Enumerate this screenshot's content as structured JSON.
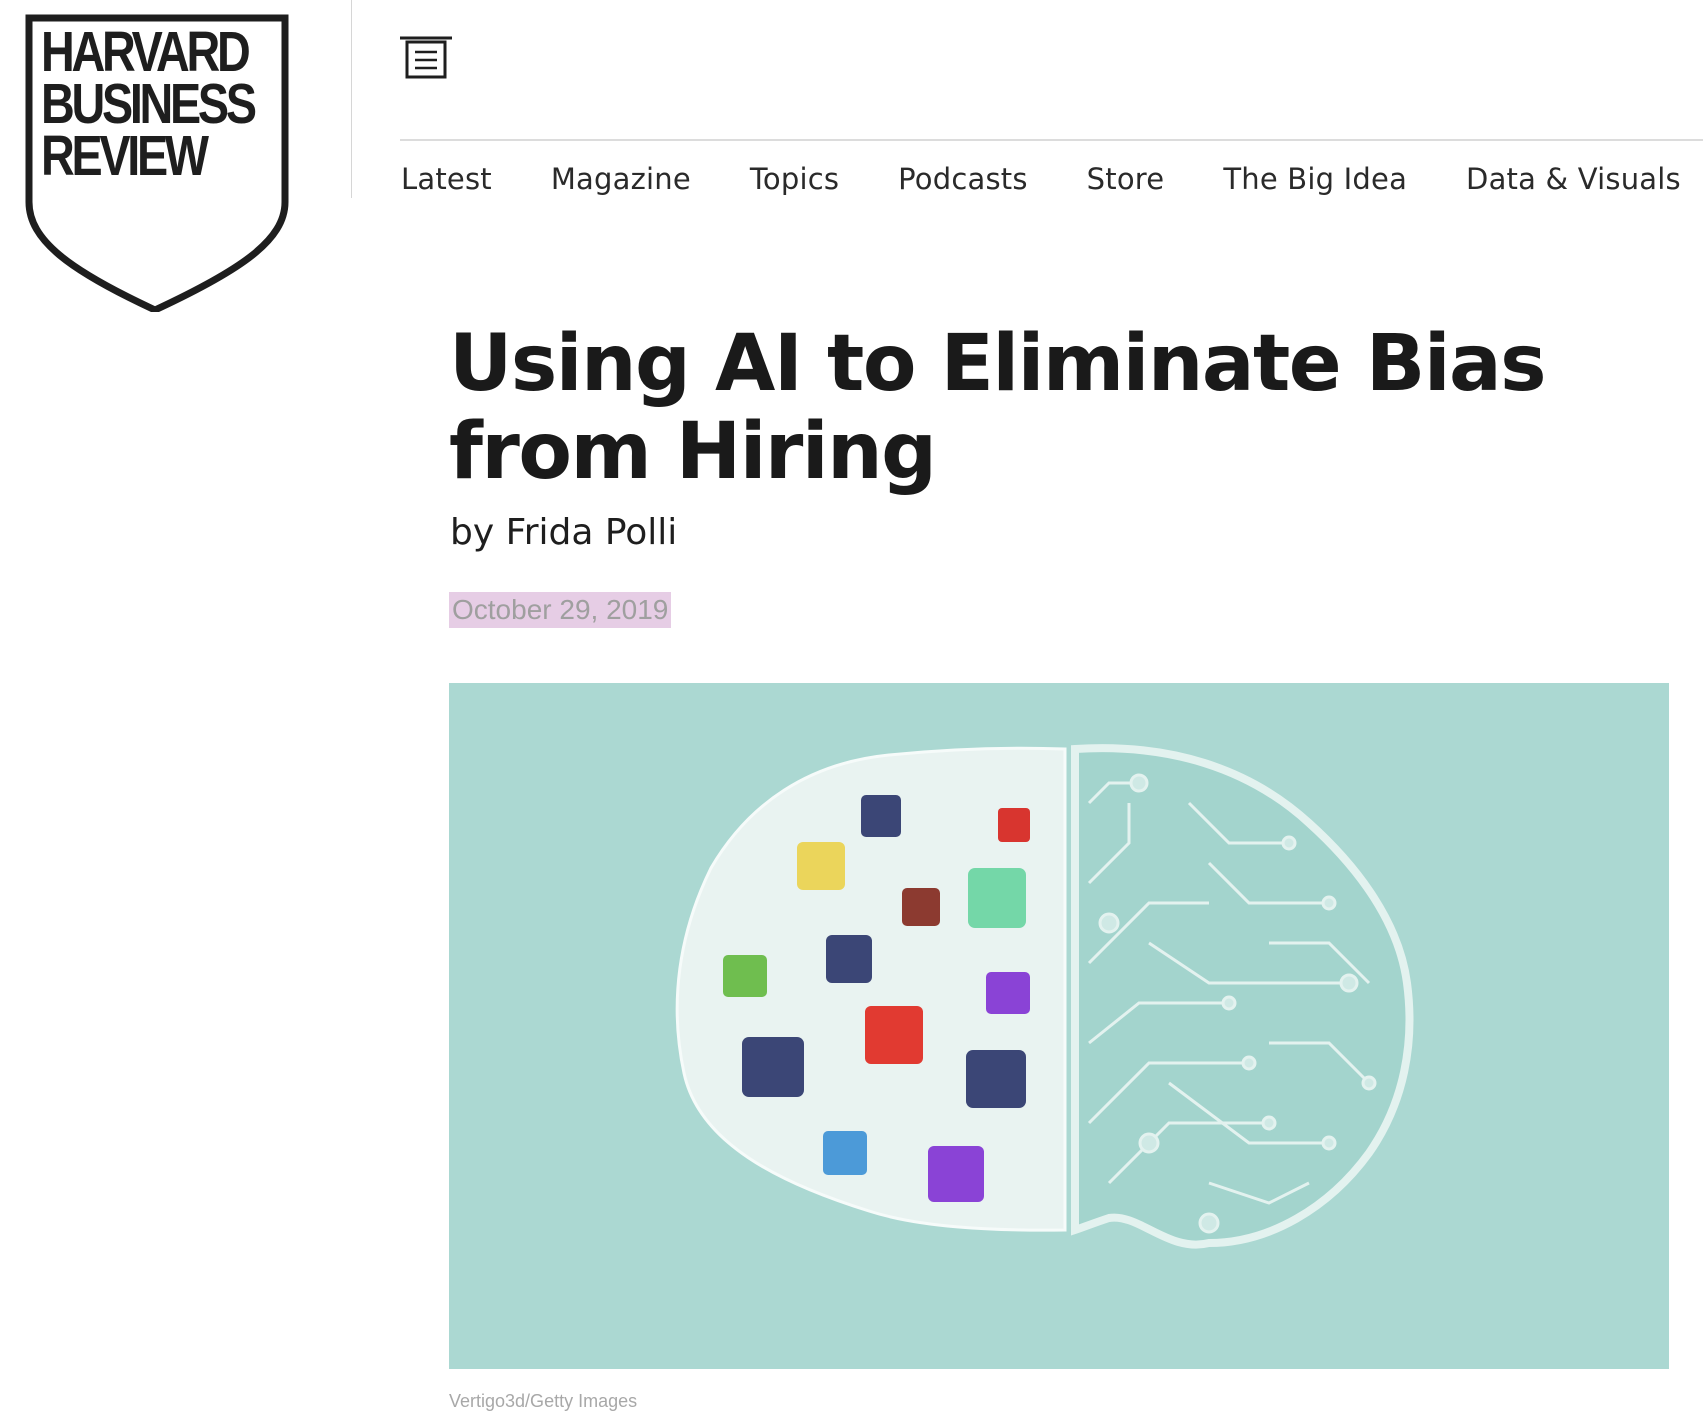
{
  "header": {
    "logo": {
      "lines": [
        "HARVARD",
        "BUSINESS",
        "REVIEW"
      ]
    },
    "menu_icon": "menu-icon"
  },
  "nav": {
    "items": [
      {
        "label": "Latest"
      },
      {
        "label": "Magazine"
      },
      {
        "label": "Topics"
      },
      {
        "label": "Podcasts"
      },
      {
        "label": "Store"
      },
      {
        "label": "The Big Idea"
      },
      {
        "label": "Data & Visuals"
      }
    ]
  },
  "article": {
    "title": "Using AI to Eliminate Bias from Hiring",
    "byline_prefix": "by",
    "author": "Frida Polli",
    "date": "October 29, 2019",
    "image_credit": "Vertigo3d/Getty Images"
  },
  "colors": {
    "date_highlight": "#e6cde5",
    "hero_background": "#abd8d2",
    "text": "#1a1a1a"
  }
}
